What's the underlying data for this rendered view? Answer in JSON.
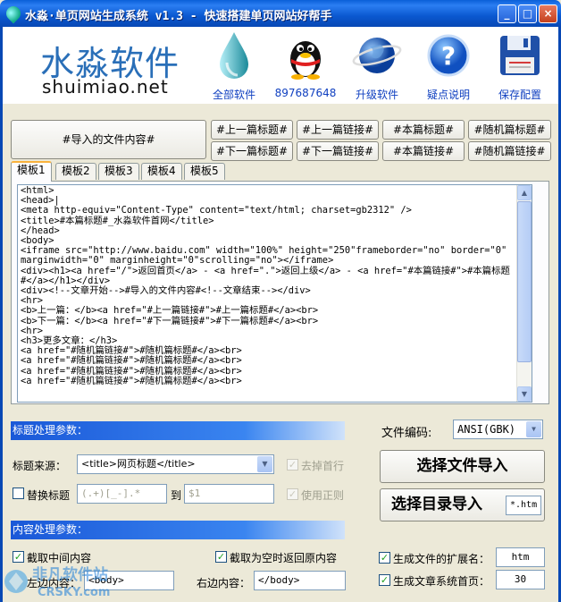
{
  "window": {
    "title": "水淼·单页网站生成系统 v1.3 - 快速搭建单页网站好帮手",
    "minimize": "_",
    "maximize": "□",
    "close": "×"
  },
  "brand": {
    "name_cn": "水淼软件",
    "name_en": "shuimiao.net"
  },
  "toolbar": {
    "items": [
      {
        "label": "全部软件",
        "icon": "water-drop-icon"
      },
      {
        "label": "897687648",
        "icon": "qq-penguin-icon"
      },
      {
        "label": "升级软件",
        "icon": "globe-icon"
      },
      {
        "label": "疑点说明",
        "icon": "help-icon"
      },
      {
        "label": "保存配置",
        "icon": "floppy-disk-icon"
      }
    ]
  },
  "insert_buttons": {
    "import_content": "#导入的文件内容#",
    "row1": [
      "#上一篇标题#",
      "#上一篇链接#",
      "#本篇标题#",
      "#随机篇标题#"
    ],
    "row2": [
      "#下一篇标题#",
      "#下一篇链接#",
      "#本篇链接#",
      "#随机篇链接#"
    ]
  },
  "tabs": [
    "模板1",
    "模板2",
    "模板3",
    "模板4",
    "模板5"
  ],
  "editor": {
    "content": "<html>\n<head>|\n<meta http-equiv=\"Content-Type\" content=\"text/html; charset=gb2312\" />\n<title>#本篇标题#_水淼软件首网</title>\n</head>\n<body>\n<iframe src=\"http://www.baidu.com\" width=\"100%\" height=\"250\"frameborder=\"no\" border=\"0\"\nmarginwidth=\"0\" marginheight=\"0\"scrolling=\"no\"></iframe>\n<div><h1><a href=\"/\">返回首页</a> - <a href=\".\">返回上级</a> - <a href=\"#本篇链接#\">#本篇标题\n#</a></h1></div>\n<div><!--文章开始-->#导入的文件内容#<!--文章结束--></div>\n<hr>\n<b>上一篇：</b><a href=\"#上一篇链接#\">#上一篇标题#</a><br>\n<b>下一篇：</b><a href=\"#下一篇链接#\">#下一篇标题#</a><br>\n<hr>\n<h3>更多文章：</h3>\n<a href=\"#随机篇链接#\">#随机篇标题#</a><br>\n<a href=\"#随机篇链接#\">#随机篇标题#</a><br>\n<a href=\"#随机篇链接#\">#随机篇标题#</a><br>\n<a href=\"#随机篇链接#\">#随机篇标题#</a><br>"
  },
  "title_section": {
    "header": "标题处理参数：",
    "source_label": "标题来源：",
    "source_value": "<title>网页标题</title>",
    "remove_first_line": "去掉首行",
    "replace_title": "替换标题",
    "replace_from": "(.+)[_-].*",
    "to_label": "到",
    "replace_to": "$1",
    "use_regex": "使用正则"
  },
  "content_section": {
    "header": "内容处理参数：",
    "extract_middle": "截取中间内容",
    "empty_return_original": "截取为空时返回原内容",
    "left_label": "左边内容：",
    "left_value": "<body>",
    "right_label": "右边内容：",
    "right_value": "</body>"
  },
  "right_panel": {
    "encoding_label": "文件编码:",
    "encoding_value": "ANSI(GBK)",
    "import_file": "选择文件导入",
    "import_dir": "选择目录导入",
    "dir_ext": "*.htm",
    "gen_ext_label": "生成文件的扩展名：",
    "gen_ext_value": "htm",
    "gen_index_label": "生成文章系统首页：",
    "gen_index_value": "30"
  },
  "watermark": {
    "text1": "非凡软件站",
    "text2": "CRSKY.com"
  }
}
